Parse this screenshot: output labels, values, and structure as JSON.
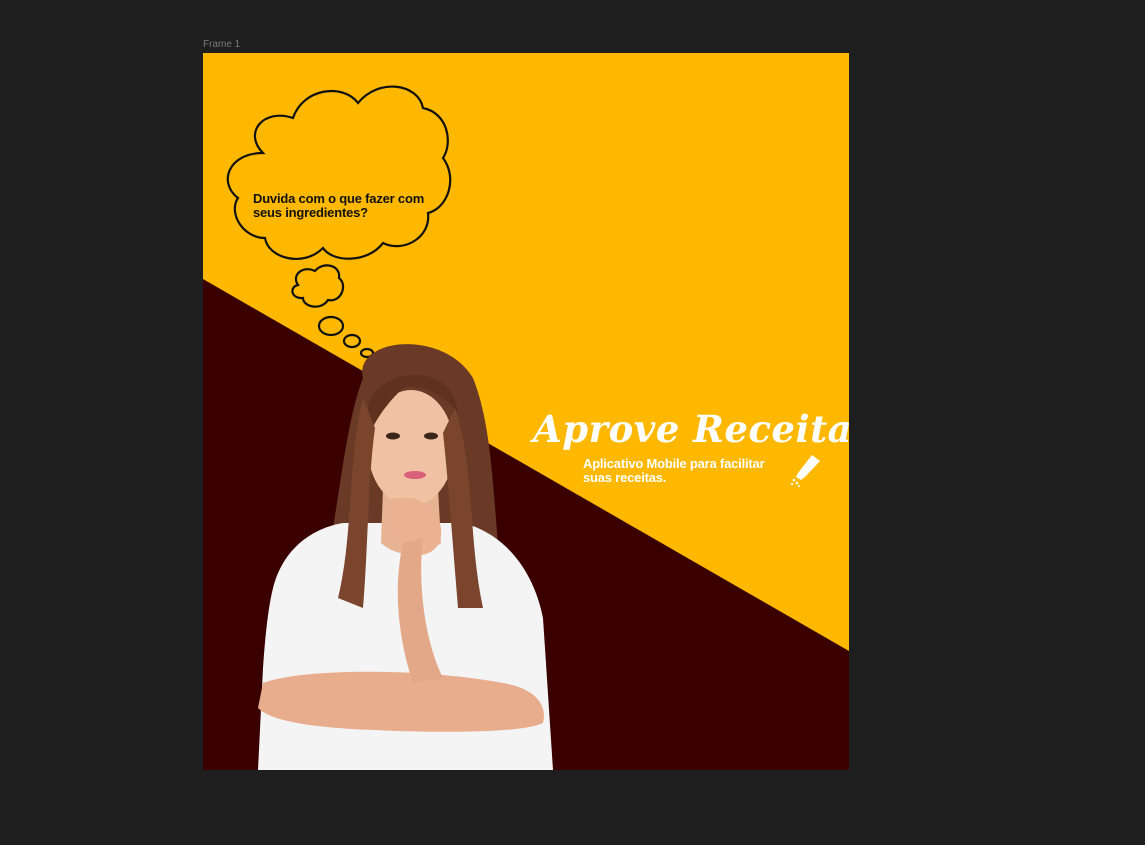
{
  "canvas": {
    "frame_label": "Frame 1",
    "background": "#1e1e1e"
  },
  "design": {
    "colors": {
      "yellow": "#ffb800",
      "maroon": "#3a0000",
      "text_light": "#ffffff",
      "text_dark": "#111111"
    },
    "thought_bubble": {
      "text": "Duvida com o que fazer com seus ingredientes?"
    },
    "app_title": "Aprove Receitas",
    "app_subtitle": "Aplicativo Mobile para facilitar suas receitas.",
    "icons": [
      "thought-bubble-icon",
      "pencil-icon"
    ]
  }
}
